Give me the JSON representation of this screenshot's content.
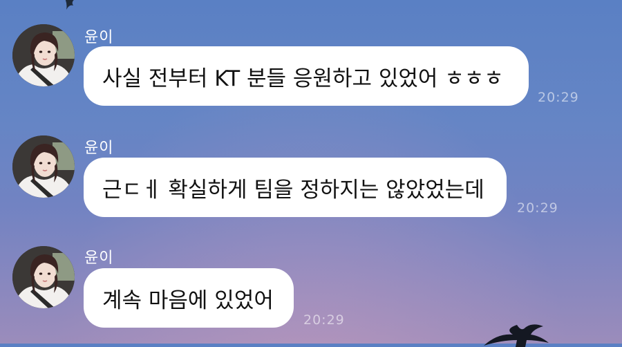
{
  "chat": {
    "messages": [
      {
        "sender": "윤이",
        "text": "사실 전부터 KT 분들 응원하고 있었어 ㅎㅎㅎ",
        "time": "20:29"
      },
      {
        "sender": "윤이",
        "text": "근ㄷㅔ 확실하게 팀을 정하지는 않았었는데",
        "time": "20:29"
      },
      {
        "sender": "윤이",
        "text": "계속 마음에 있었어",
        "time": "20:29"
      }
    ]
  }
}
